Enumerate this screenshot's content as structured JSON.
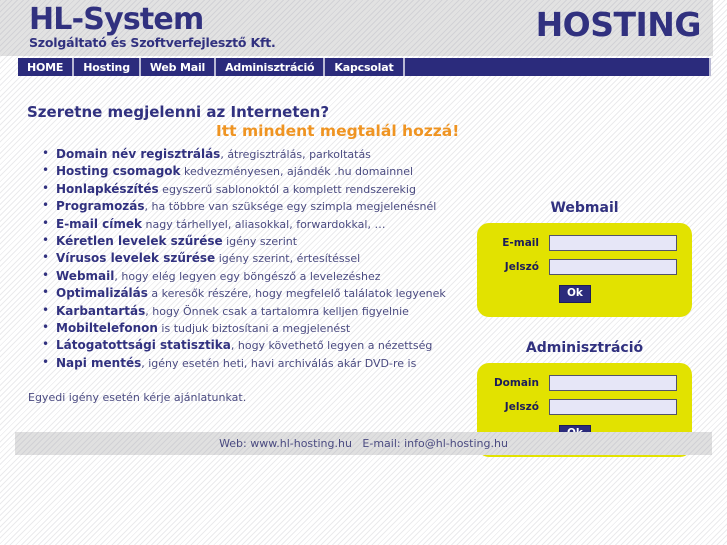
{
  "colors": {
    "brand_navy": "#31317f",
    "nav_navy": "#2b2b7c",
    "accent_orange": "#ef9422",
    "panel_yellow": "#e2e200",
    "input_lavender": "#e6e6f7",
    "band_gray": "#e2e2e2"
  },
  "header": {
    "logo_title": "HL-System",
    "logo_subtitle": "Szolgáltató és Szoftverfejlesztő Kft.",
    "hosting_word": "HOSTING"
  },
  "nav": {
    "items": [
      {
        "label": "HOME"
      },
      {
        "label": "Hosting"
      },
      {
        "label": "Web Mail"
      },
      {
        "label": "Adminisztráció"
      },
      {
        "label": "Kapcsolat"
      }
    ]
  },
  "main": {
    "headline": "Szeretne megjelenni az Interneten?",
    "subheadline": "Itt mindent megtalál hozzá!",
    "features": [
      {
        "lead": "Domain név regisztrálás",
        "rest": ", átregisztrálás, parkoltatás"
      },
      {
        "lead": "Hosting csomagok",
        "rest": " kedvezményesen, ajándék .hu domainnel"
      },
      {
        "lead": "Honlapkészítés",
        "rest": " egyszerű sablonoktól a komplett rendszerekig"
      },
      {
        "lead": "Programozás",
        "rest": ", ha többre van szüksége egy szimpla megjelenésnél"
      },
      {
        "lead": "E-mail címek",
        "rest": " nagy tárhellyel, aliasokkal, forwardokkal, …"
      },
      {
        "lead": "Kéretlen levelek szűrése",
        "rest": " igény szerint"
      },
      {
        "lead": "Vírusos levelek szűrése",
        "rest": " igény szerint, értesítéssel"
      },
      {
        "lead": "Webmail",
        "rest": ", hogy elég legyen egy böngésző a levelezéshez"
      },
      {
        "lead": "Optimalizálás",
        "rest": " a keresők részére, hogy megfelelő találatok legyenek"
      },
      {
        "lead": "Karbantartás",
        "rest": ", hogy Önnek csak a tartalomra kelljen figyelnie"
      },
      {
        "lead": "Mobiltelefonon",
        "rest": " is tudjuk biztosítani a megjelenést"
      },
      {
        "lead": "Látogatottsági statisztika",
        "rest": ", hogy követhető legyen a nézettség"
      },
      {
        "lead": "Napi mentés",
        "rest": ", igény esetén heti, havi archiválás akár DVD-re is"
      }
    ],
    "closing_line": "Egyedi igény esetén kérje ajánlatunkat."
  },
  "webmail_panel": {
    "title": "Webmail",
    "email_label": "E-mail",
    "email_value": "",
    "email_placeholder": "",
    "password_label": "Jelszó",
    "password_value": "",
    "password_placeholder": "",
    "submit_label": "Ok"
  },
  "admin_panel": {
    "title": "Adminisztráció",
    "domain_label": "Domain",
    "domain_value": "",
    "domain_placeholder": "",
    "password_label": "Jelszó",
    "password_value": "",
    "password_placeholder": "",
    "submit_label": "Ok"
  },
  "footer": {
    "text": "Web: www.hl-hosting.hu   E-mail: info@hl-hosting.hu"
  }
}
